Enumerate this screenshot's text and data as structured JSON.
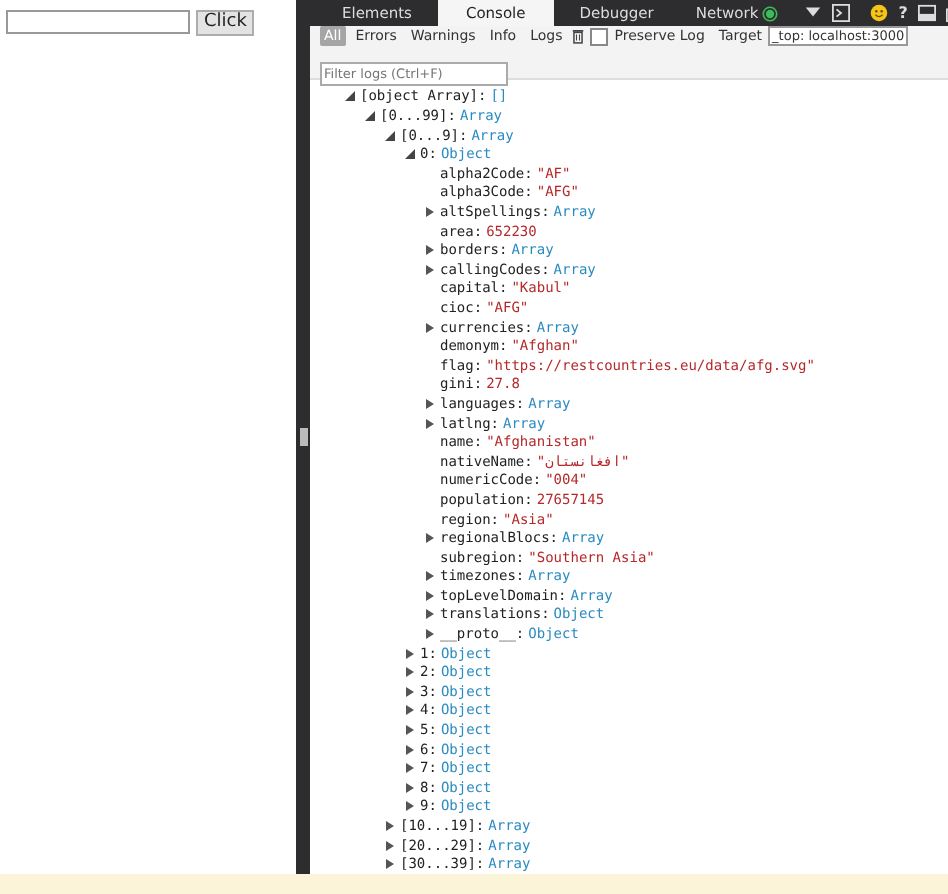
{
  "page": {
    "button": "Click"
  },
  "devtools": {
    "tabs": [
      {
        "label": "Elements",
        "selected": false
      },
      {
        "label": "Console",
        "selected": true
      },
      {
        "label": "Debugger",
        "selected": false
      },
      {
        "label": "Network",
        "selected": false,
        "recording": true
      }
    ],
    "help": "?",
    "filters": [
      {
        "label": "All",
        "selected": true
      },
      {
        "label": "Errors",
        "selected": false
      },
      {
        "label": "Warnings",
        "selected": false
      },
      {
        "label": "Info",
        "selected": false
      },
      {
        "label": "Logs",
        "selected": false
      }
    ],
    "preserve_log": {
      "label": "Preserve Log",
      "checked": false
    },
    "target": {
      "label": "Target",
      "value": "_top: localhost:3000"
    },
    "filter_field": {
      "placeholder": "Filter logs (Ctrl+F)"
    },
    "tree": [
      {
        "key": "[object Array]:",
        "value": "[]",
        "kind": "type",
        "expanded": true,
        "children": [
          {
            "key": "[0...99]:",
            "value": "Array",
            "kind": "type",
            "expanded": true,
            "children": [
              {
                "key": "[0...9]:",
                "value": "Array",
                "kind": "type",
                "expanded": true,
                "children": [
                  {
                    "key": "0:",
                    "value": "Object",
                    "kind": "type",
                    "expanded": true,
                    "children": [
                      {
                        "key": "alpha2Code:",
                        "value": "\"AF\"",
                        "kind": "literal"
                      },
                      {
                        "key": "alpha3Code:",
                        "value": "\"AFG\"",
                        "kind": "literal"
                      },
                      {
                        "key": "altSpellings:",
                        "value": "Array",
                        "kind": "type",
                        "expanded": false
                      },
                      {
                        "key": "area:",
                        "value": "652230",
                        "kind": "literal"
                      },
                      {
                        "key": "borders:",
                        "value": "Array",
                        "kind": "type",
                        "expanded": false
                      },
                      {
                        "key": "callingCodes:",
                        "value": "Array",
                        "kind": "type",
                        "expanded": false
                      },
                      {
                        "key": "capital:",
                        "value": "\"Kabul\"",
                        "kind": "literal"
                      },
                      {
                        "key": "cioc:",
                        "value": "\"AFG\"",
                        "kind": "literal"
                      },
                      {
                        "key": "currencies:",
                        "value": "Array",
                        "kind": "type",
                        "expanded": false
                      },
                      {
                        "key": "demonym:",
                        "value": "\"Afghan\"",
                        "kind": "literal"
                      },
                      {
                        "key": "flag:",
                        "value": "\"https://restcountries.eu/data/afg.svg\"",
                        "kind": "literal"
                      },
                      {
                        "key": "gini:",
                        "value": "27.8",
                        "kind": "literal"
                      },
                      {
                        "key": "languages:",
                        "value": "Array",
                        "kind": "type",
                        "expanded": false
                      },
                      {
                        "key": "latlng:",
                        "value": "Array",
                        "kind": "type",
                        "expanded": false
                      },
                      {
                        "key": "name:",
                        "value": "\"Afghanistan\"",
                        "kind": "literal"
                      },
                      {
                        "key": "nativeName:",
                        "value": "\"افغانستان\"",
                        "kind": "literal"
                      },
                      {
                        "key": "numericCode:",
                        "value": "\"004\"",
                        "kind": "literal"
                      },
                      {
                        "key": "population:",
                        "value": "27657145",
                        "kind": "literal"
                      },
                      {
                        "key": "region:",
                        "value": "\"Asia\"",
                        "kind": "literal"
                      },
                      {
                        "key": "regionalBlocs:",
                        "value": "Array",
                        "kind": "type",
                        "expanded": false
                      },
                      {
                        "key": "subregion:",
                        "value": "\"Southern Asia\"",
                        "kind": "literal"
                      },
                      {
                        "key": "timezones:",
                        "value": "Array",
                        "kind": "type",
                        "expanded": false
                      },
                      {
                        "key": "topLevelDomain:",
                        "value": "Array",
                        "kind": "type",
                        "expanded": false
                      },
                      {
                        "key": "translations:",
                        "value": "Object",
                        "kind": "type",
                        "expanded": false
                      },
                      {
                        "key": "__proto__:",
                        "value": "Object",
                        "kind": "type",
                        "expanded": false
                      }
                    ]
                  },
                  {
                    "key": "1:",
                    "value": "Object",
                    "kind": "type",
                    "expanded": false
                  },
                  {
                    "key": "2:",
                    "value": "Object",
                    "kind": "type",
                    "expanded": false
                  },
                  {
                    "key": "3:",
                    "value": "Object",
                    "kind": "type",
                    "expanded": false
                  },
                  {
                    "key": "4:",
                    "value": "Object",
                    "kind": "type",
                    "expanded": false
                  },
                  {
                    "key": "5:",
                    "value": "Object",
                    "kind": "type",
                    "expanded": false
                  },
                  {
                    "key": "6:",
                    "value": "Object",
                    "kind": "type",
                    "expanded": false
                  },
                  {
                    "key": "7:",
                    "value": "Object",
                    "kind": "type",
                    "expanded": false
                  },
                  {
                    "key": "8:",
                    "value": "Object",
                    "kind": "type",
                    "expanded": false
                  },
                  {
                    "key": "9:",
                    "value": "Object",
                    "kind": "type",
                    "expanded": false
                  }
                ]
              },
              {
                "key": "[10...19]:",
                "value": "Array",
                "kind": "type",
                "expanded": false
              },
              {
                "key": "[20...29]:",
                "value": "Array",
                "kind": "type",
                "expanded": false
              },
              {
                "key": "[30...39]:",
                "value": "Array",
                "kind": "type",
                "expanded": false
              }
            ]
          }
        ]
      }
    ]
  }
}
